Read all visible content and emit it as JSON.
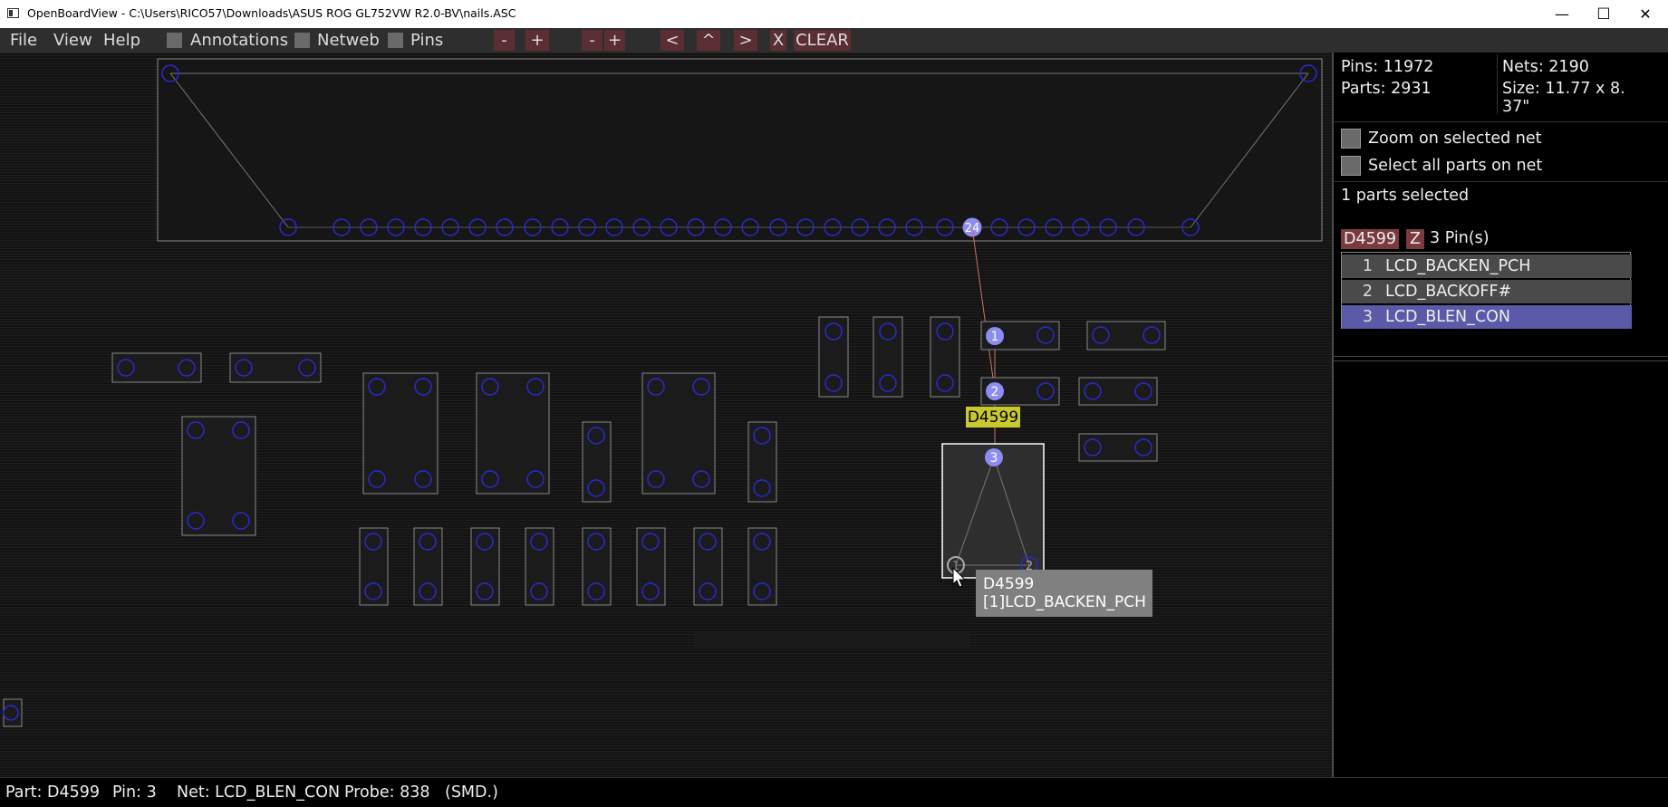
{
  "window": {
    "title": "OpenBoardView - C:\\Users\\RICO57\\Downloads\\ASUS ROG GL752VW R2.0-BV\\nails.ASC",
    "minimize_glyph": "—",
    "maximize_glyph": "☐",
    "close_glyph": "✕"
  },
  "menu": {
    "file": "File",
    "view": "View",
    "help": "Help",
    "annotations": "Annotations",
    "netweb": "Netweb",
    "pins": "Pins"
  },
  "toolbar": {
    "zoom_out": "-",
    "zoom_in": "+",
    "zoom_out2": "-",
    "zoom_in2": "+",
    "back": "<",
    "up": "^",
    "forward": ">",
    "x": "X",
    "clear": "CLEAR"
  },
  "stats": {
    "pins": "Pins: 11972",
    "nets": "Nets: 2190",
    "parts": "Parts: 2931",
    "size_line1": "Size: 11.77 x 8.",
    "size_line2": "37\""
  },
  "options": {
    "zoom_on_net": "Zoom on selected net",
    "select_all_parts": "Select all parts on net"
  },
  "selection": {
    "summary": "1 parts selected",
    "part_name": "D4599",
    "z_button": "Z",
    "pin_count": "3 Pin(s)"
  },
  "pin_list": [
    {
      "num": "1",
      "net": "LCD_BACKEN_PCH",
      "selected": false
    },
    {
      "num": "2",
      "net": "LCD_BACKOFF#",
      "selected": false
    },
    {
      "num": "3",
      "net": "LCD_BLEN_CON",
      "selected": true
    }
  ],
  "board": {
    "connector_pin_label": "24",
    "pin1_label": "1",
    "pin2_label": "2",
    "pin3_label": "3",
    "part_label": "D4599",
    "part_pin1_label": "1",
    "part_pin2_label": "2",
    "tooltip_line1": "D4599",
    "tooltip_line2": "[1]LCD_BACKEN_PCH"
  },
  "status": {
    "part": "Part: D4599",
    "pin": "Pin: 3",
    "net": "Net: LCD_BLEN_CON",
    "probe": "Probe: 838",
    "type": "(SMD.)"
  },
  "colors": {
    "pin_circle": "#2a2ad0",
    "selected_pin": "#8c8cf5",
    "part_outline": "#8a8a8a",
    "highlight_part": "#ffffff",
    "label_bg": "#c9c92e",
    "toolbar_button": "#5a2e33",
    "selected_row": "#5a5aa8"
  }
}
